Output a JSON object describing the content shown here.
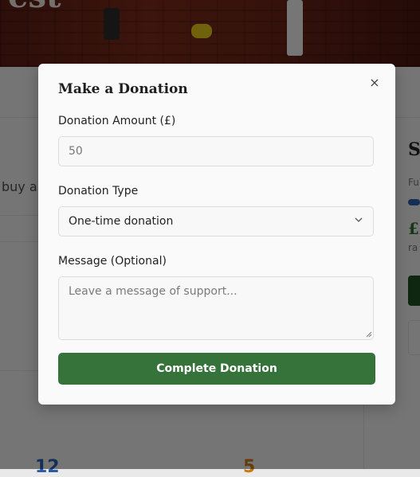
{
  "background": {
    "hero_title": "est",
    "body_snippet": "buy a",
    "side_heading": "S",
    "side_label_top": "Fu",
    "side_amount": "£",
    "side_label_bottom": "ra",
    "stats": [
      "12",
      "5"
    ]
  },
  "modal": {
    "title": "Make a Donation",
    "close_glyph": "×",
    "amount": {
      "label": "Donation Amount (£)",
      "value": "50"
    },
    "type": {
      "label": "Donation Type",
      "selected": "One-time donation"
    },
    "message": {
      "label": "Message (Optional)",
      "placeholder": "Leave a message of support..."
    },
    "submit_label": "Complete Donation"
  },
  "colors": {
    "accent": "#35733a",
    "overlay": "rgba(0,0,0,0.5)"
  }
}
